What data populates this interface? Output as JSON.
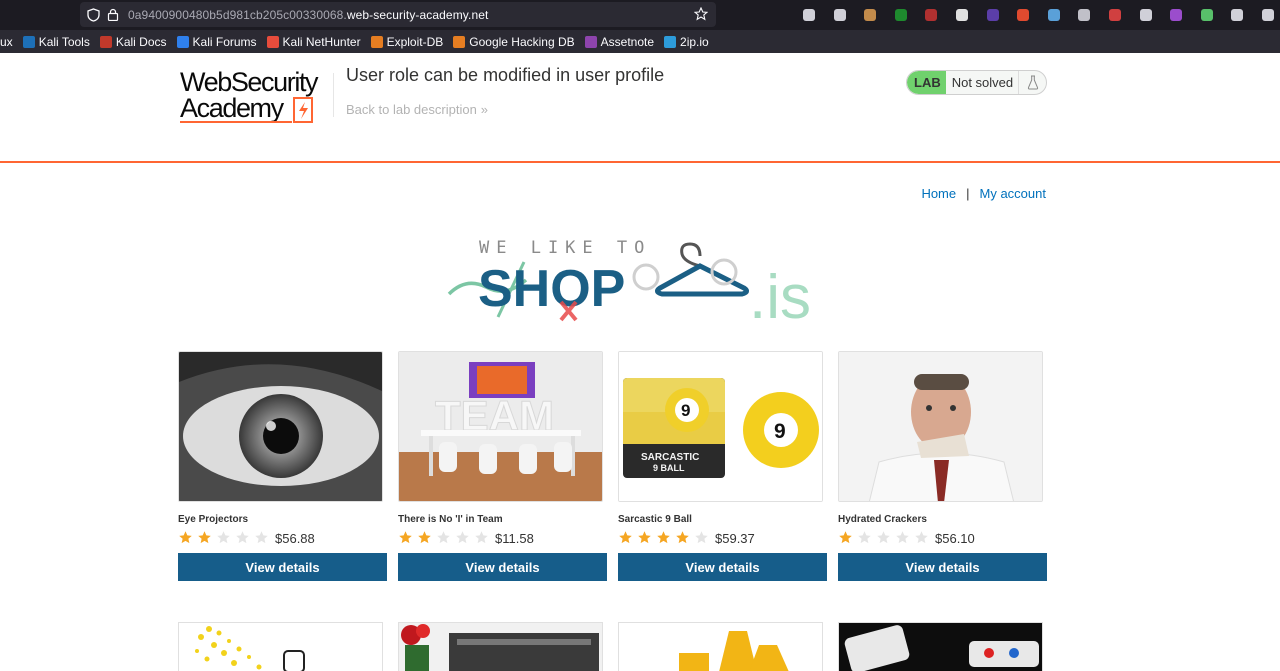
{
  "browser": {
    "url_prefix": "0a9400900480b5d981cb205c00330068.",
    "url_domain": "web-security-academy.net",
    "bookmarks": [
      {
        "label": "ux",
        "color": "#2b2a33"
      },
      {
        "label": "Kali Tools",
        "color": "#1d70b8"
      },
      {
        "label": "Kali Docs",
        "color": "#c0392b"
      },
      {
        "label": "Kali Forums",
        "color": "#2f80ed"
      },
      {
        "label": "Kali NetHunter",
        "color": "#e74c3c"
      },
      {
        "label": "Exploit-DB",
        "color": "#e67e22"
      },
      {
        "label": "Google Hacking DB",
        "color": "#e67e22"
      },
      {
        "label": "Assetnote",
        "color": "#8e44ad"
      },
      {
        "label": "2ip.io",
        "color": "#2d9cdb"
      }
    ],
    "extensions": [
      {
        "name": "download-icon",
        "color": "#d0d0d8"
      },
      {
        "name": "puzzle-extension-icon",
        "color": "#d0d0d8"
      },
      {
        "name": "shield-extension-icon",
        "color": "#c28b4b"
      },
      {
        "name": "wappalyzer-extension-icon",
        "color": "#1e8a2e"
      },
      {
        "name": "ublock-extension-icon",
        "color": "#b03030"
      },
      {
        "name": "cookie-extension-icon",
        "color": "#e0e0e0"
      },
      {
        "name": "foxyproxy-extension-icon",
        "color": "#5b3ea8"
      },
      {
        "name": "hackbar-extension-icon",
        "color": "#e04a2f"
      },
      {
        "name": "network-extension-icon",
        "color": "#5aa0d8"
      },
      {
        "name": "circle-extension-icon",
        "color": "#c0c0c8"
      },
      {
        "name": "notification-extension-icon",
        "color": "#d04040"
      },
      {
        "name": "ab-extension-icon",
        "color": "#d0d0d8"
      },
      {
        "name": "feather-extension-icon",
        "color": "#9b4dcc"
      },
      {
        "name": "chat-extension-icon",
        "color": "#58c06a"
      },
      {
        "name": "settings-extension-icon",
        "color": "#d0d0d8"
      },
      {
        "name": "menu-extension-icon",
        "color": "#d0d0d8"
      }
    ]
  },
  "lab": {
    "logo_line1": "WebSecurity",
    "logo_line2": "Academy",
    "title": "User role can be modified in user profile",
    "back_link": "Back to lab description",
    "back_chevron": "»",
    "lab_tag": "LAB",
    "status": "Not solved",
    "accent": "#ff6633"
  },
  "nav": {
    "home": "Home",
    "separator": "|",
    "my_account": "My account"
  },
  "banner": {
    "tagline": "WE LIKE TO",
    "word": "SHOP",
    "suffix": ".is"
  },
  "products": [
    {
      "name": "Eye Projectors",
      "rating": 2,
      "price": "$56.88",
      "button": "View details",
      "image": "eye"
    },
    {
      "name": "There is No 'I' in Team",
      "rating": 2,
      "price": "$11.58",
      "button": "View details",
      "image": "team"
    },
    {
      "name": "Sarcastic 9 Ball",
      "rating": 4,
      "price": "$59.37",
      "button": "View details",
      "image": "ball"
    },
    {
      "name": "Hydrated Crackers",
      "rating": 1,
      "price": "$56.10",
      "button": "View details",
      "image": "crackers"
    }
  ],
  "colors": {
    "button": "#165d8a",
    "link": "#0071bc",
    "star_on": "#f5a623",
    "star_off": "#e4e4e4"
  }
}
